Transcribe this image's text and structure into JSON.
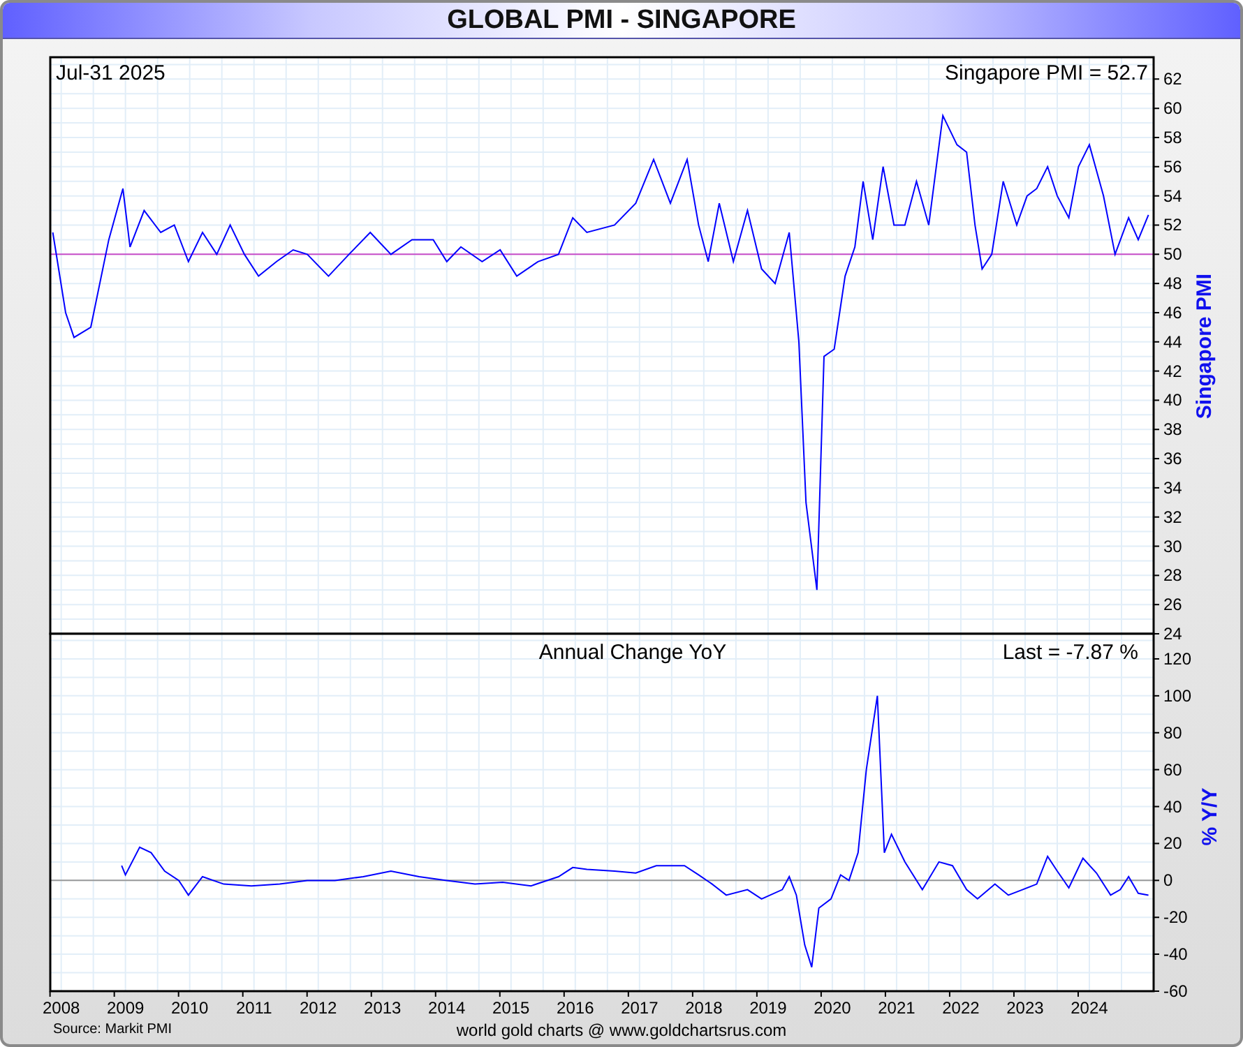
{
  "title": "GLOBAL PMI - SINGAPORE",
  "top_panel": {
    "date_label": "Jul-31  2025",
    "reading": "Singapore PMI = 52.7",
    "chart_data": {
      "type": "line",
      "x": [
        2007.87,
        2008.07,
        2008.2,
        2008.46,
        2008.74,
        2008.96,
        2009.07,
        2009.29,
        2009.55,
        2009.76,
        2009.98,
        2010.2,
        2010.42,
        2010.63,
        2010.85,
        2011.07,
        2011.35,
        2011.61,
        2011.83,
        2012.16,
        2012.48,
        2012.81,
        2013.13,
        2013.46,
        2013.79,
        2014.0,
        2014.22,
        2014.55,
        2014.83,
        2015.09,
        2015.42,
        2015.74,
        2015.96,
        2016.18,
        2016.61,
        2016.94,
        2017.22,
        2017.48,
        2017.74,
        2017.92,
        2018.07,
        2018.24,
        2018.46,
        2018.68,
        2018.9,
        2019.11,
        2019.33,
        2019.48,
        2019.59,
        2019.76,
        2019.87,
        2020.03,
        2020.2,
        2020.35,
        2020.48,
        2020.63,
        2020.79,
        2020.96,
        2021.13,
        2021.31,
        2021.5,
        2021.72,
        2021.94,
        2022.09,
        2022.22,
        2022.33,
        2022.48,
        2022.66,
        2022.87,
        2023.03,
        2023.18,
        2023.35,
        2023.5,
        2023.68,
        2023.83,
        2024.0,
        2024.22,
        2024.4,
        2024.61,
        2024.76,
        2024.92
      ],
      "series": [
        {
          "name": "Singapore PMI",
          "color": "#0000ff",
          "values": [
            51.5,
            46,
            44.3,
            45,
            51,
            54.5,
            50.5,
            53,
            51.5,
            52,
            49.5,
            51.5,
            50,
            52,
            50,
            48.5,
            49.5,
            50.3,
            50,
            48.5,
            50,
            51.5,
            50,
            51,
            51,
            49.5,
            50.5,
            49.5,
            50.3,
            48.5,
            49.5,
            50,
            52.5,
            51.5,
            52,
            53.5,
            56.5,
            53.5,
            56.5,
            52,
            49.5,
            53.5,
            49.5,
            53,
            49,
            48,
            51.5,
            44,
            33,
            27,
            43,
            43.5,
            48.5,
            50.5,
            55,
            51,
            56,
            52,
            52,
            55,
            52,
            59.5,
            57.5,
            57,
            52,
            49,
            50,
            55,
            52,
            54,
            54.5,
            56,
            54,
            52.5,
            56,
            57.5,
            54,
            50,
            52.5,
            51,
            52.7
          ]
        }
      ],
      "xlim": [
        2007.83,
        2025.0
      ],
      "ylim": [
        24,
        63.5
      ],
      "yticks": [
        24,
        26,
        28,
        30,
        32,
        34,
        36,
        38,
        40,
        42,
        44,
        46,
        48,
        50,
        52,
        54,
        56,
        58,
        60,
        62
      ],
      "grid": true,
      "ref_lines": [
        {
          "axis": "y",
          "value": 50
        }
      ]
    }
  },
  "bottom_panel": {
    "title": "Annual Change YoY",
    "reading": "Last = -7.87 %",
    "chart_data": {
      "type": "line",
      "x": [
        2008.94,
        2009.0,
        2009.22,
        2009.4,
        2009.61,
        2009.83,
        2009.98,
        2010.2,
        2010.53,
        2010.96,
        2011.4,
        2011.83,
        2012.26,
        2012.7,
        2013.13,
        2013.57,
        2014.0,
        2014.44,
        2014.87,
        2015.31,
        2015.74,
        2015.96,
        2016.18,
        2016.61,
        2016.94,
        2017.26,
        2017.7,
        2017.92,
        2018.13,
        2018.35,
        2018.68,
        2018.9,
        2019.22,
        2019.33,
        2019.44,
        2019.57,
        2019.68,
        2019.79,
        2019.98,
        2020.13,
        2020.26,
        2020.4,
        2020.53,
        2020.7,
        2020.81,
        2020.92,
        2021.13,
        2021.4,
        2021.66,
        2021.87,
        2022.09,
        2022.26,
        2022.53,
        2022.74,
        2022.96,
        2023.18,
        2023.35,
        2023.5,
        2023.68,
        2023.9,
        2024.11,
        2024.33,
        2024.48,
        2024.61,
        2024.76,
        2024.92
      ],
      "series": [
        {
          "name": "% Y/Y",
          "color": "#0000ff",
          "values": [
            8,
            3,
            18,
            15,
            5,
            0,
            -8,
            2,
            -2,
            -3,
            -2,
            0,
            0,
            2,
            5,
            2,
            0,
            -2,
            -1,
            -3,
            2,
            7,
            6,
            5,
            4,
            8,
            8,
            3,
            -2,
            -8,
            -5,
            -10,
            -5,
            2,
            -8,
            -35,
            -47,
            -15,
            -10,
            3,
            0,
            15,
            60,
            100,
            15,
            25,
            10,
            -5,
            10,
            8,
            -5,
            -10,
            -2,
            -8,
            -5,
            -2,
            13,
            5,
            -4,
            12,
            4,
            -8,
            -5,
            2,
            -7,
            -8
          ]
        }
      ],
      "xlim": [
        2007.83,
        2025.0
      ],
      "ylim": [
        -60,
        133.6
      ],
      "xticks": [
        2008,
        2009,
        2010,
        2011,
        2012,
        2013,
        2014,
        2015,
        2016,
        2017,
        2018,
        2019,
        2020,
        2021,
        2022,
        2023,
        2024
      ],
      "yticks": [
        -60,
        -40,
        -20,
        0,
        20,
        40,
        60,
        80,
        100,
        120
      ],
      "grid": true
    }
  },
  "footer": {
    "source": "Source: Markit PMI",
    "credit": "world gold charts @ www.goldchartsrus.com"
  }
}
